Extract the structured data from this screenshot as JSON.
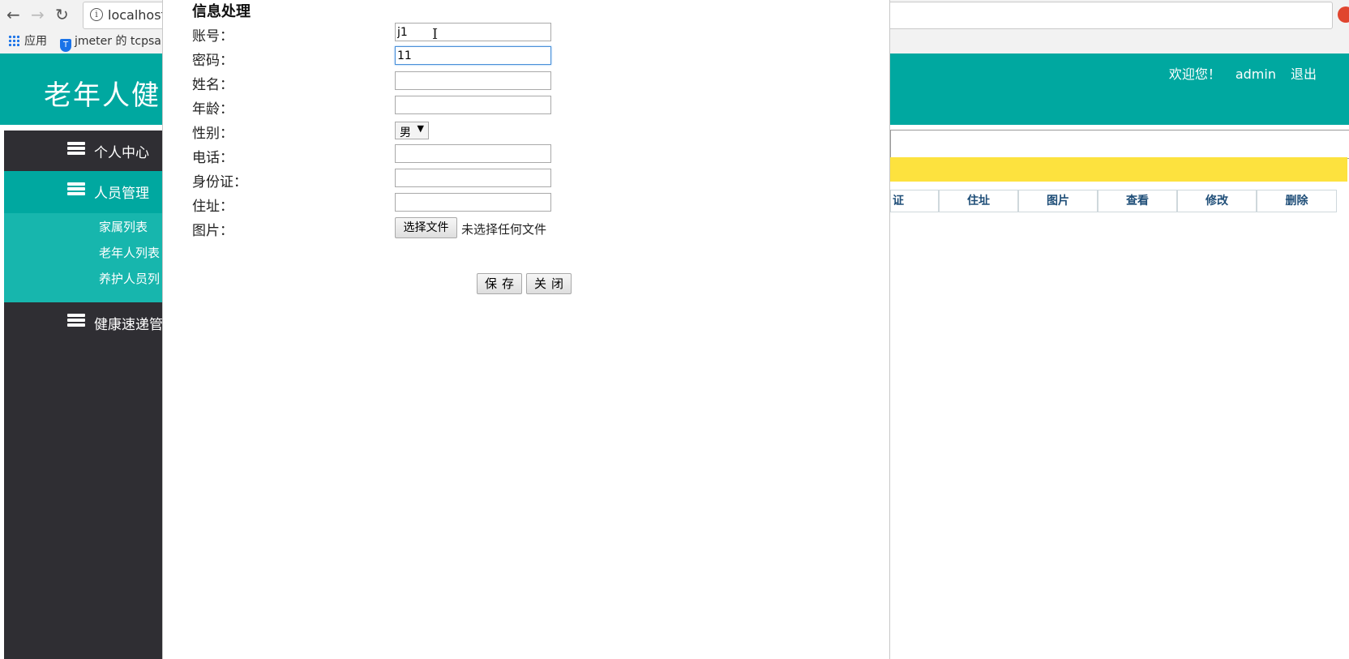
{
  "browser": {
    "url": "localhost",
    "bookmarks": {
      "apps_label": "应用",
      "item1": "jmeter 的 tcpsam"
    }
  },
  "header": {
    "title": "老年人健",
    "welcome": "欢迎您！",
    "username": "admin",
    "logout": "退出"
  },
  "sidebar": {
    "items": [
      {
        "label": "个人中心"
      },
      {
        "label": "人员管理"
      },
      {
        "label": "健康速递管"
      }
    ],
    "sub_items": [
      {
        "label": "家属列表"
      },
      {
        "label": "老年人列表"
      },
      {
        "label": "养护人员列"
      }
    ]
  },
  "table": {
    "headers": [
      "证",
      "住址",
      "图片",
      "查看",
      "修改",
      "删除"
    ]
  },
  "colors": {
    "header_teal": "#00a8a0",
    "sidebar_dark": "#2f2e33",
    "submenu_teal": "#17b6ad",
    "notice_yellow": "#fde23e"
  },
  "modal": {
    "title": "信息处理",
    "fields": {
      "account": {
        "label": "账号：",
        "value": "j1"
      },
      "password": {
        "label": "密码：",
        "value": "11"
      },
      "name": {
        "label": "姓名：",
        "value": ""
      },
      "age": {
        "label": "年龄：",
        "value": ""
      },
      "gender": {
        "label": "性别：",
        "value": "男"
      },
      "phone": {
        "label": "电话：",
        "value": ""
      },
      "idcard": {
        "label": "身份证：",
        "value": ""
      },
      "address": {
        "label": "住址：",
        "value": ""
      },
      "photo": {
        "label": "图片：",
        "button": "选择文件",
        "status": "未选择任何文件"
      }
    },
    "save_label": "保存",
    "close_label": "关闭"
  }
}
